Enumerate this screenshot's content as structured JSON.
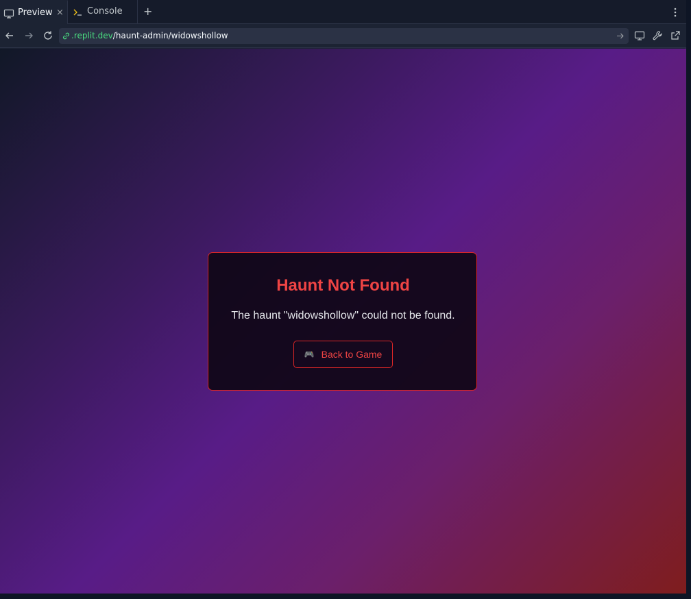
{
  "tabs": {
    "preview_label": "Preview",
    "console_label": "Console",
    "close_symbol": "×",
    "add_symbol": "+"
  },
  "address_bar": {
    "domain": ".replit.dev",
    "path": "/haunt-admin/widowshollow"
  },
  "card": {
    "title": "Haunt Not Found",
    "message": "The haunt \"widowshollow\" could not be found.",
    "button_icon": "🎮",
    "button_label": "Back to Game"
  },
  "colors": {
    "accent_red": "#ef4444",
    "url_domain": "#4ade80"
  },
  "icons": {
    "preview_tab": "monitor-icon",
    "console_tab": "terminal-icon",
    "menu": "kebab-menu-icon",
    "back": "arrow-left-icon",
    "forward": "arrow-right-icon",
    "reload": "reload-icon",
    "link": "link-icon",
    "go": "arrow-right-icon",
    "devices": "monitor-icon",
    "devtools": "wrench-icon",
    "open_new": "external-link-icon",
    "button": "gamepad-icon"
  }
}
